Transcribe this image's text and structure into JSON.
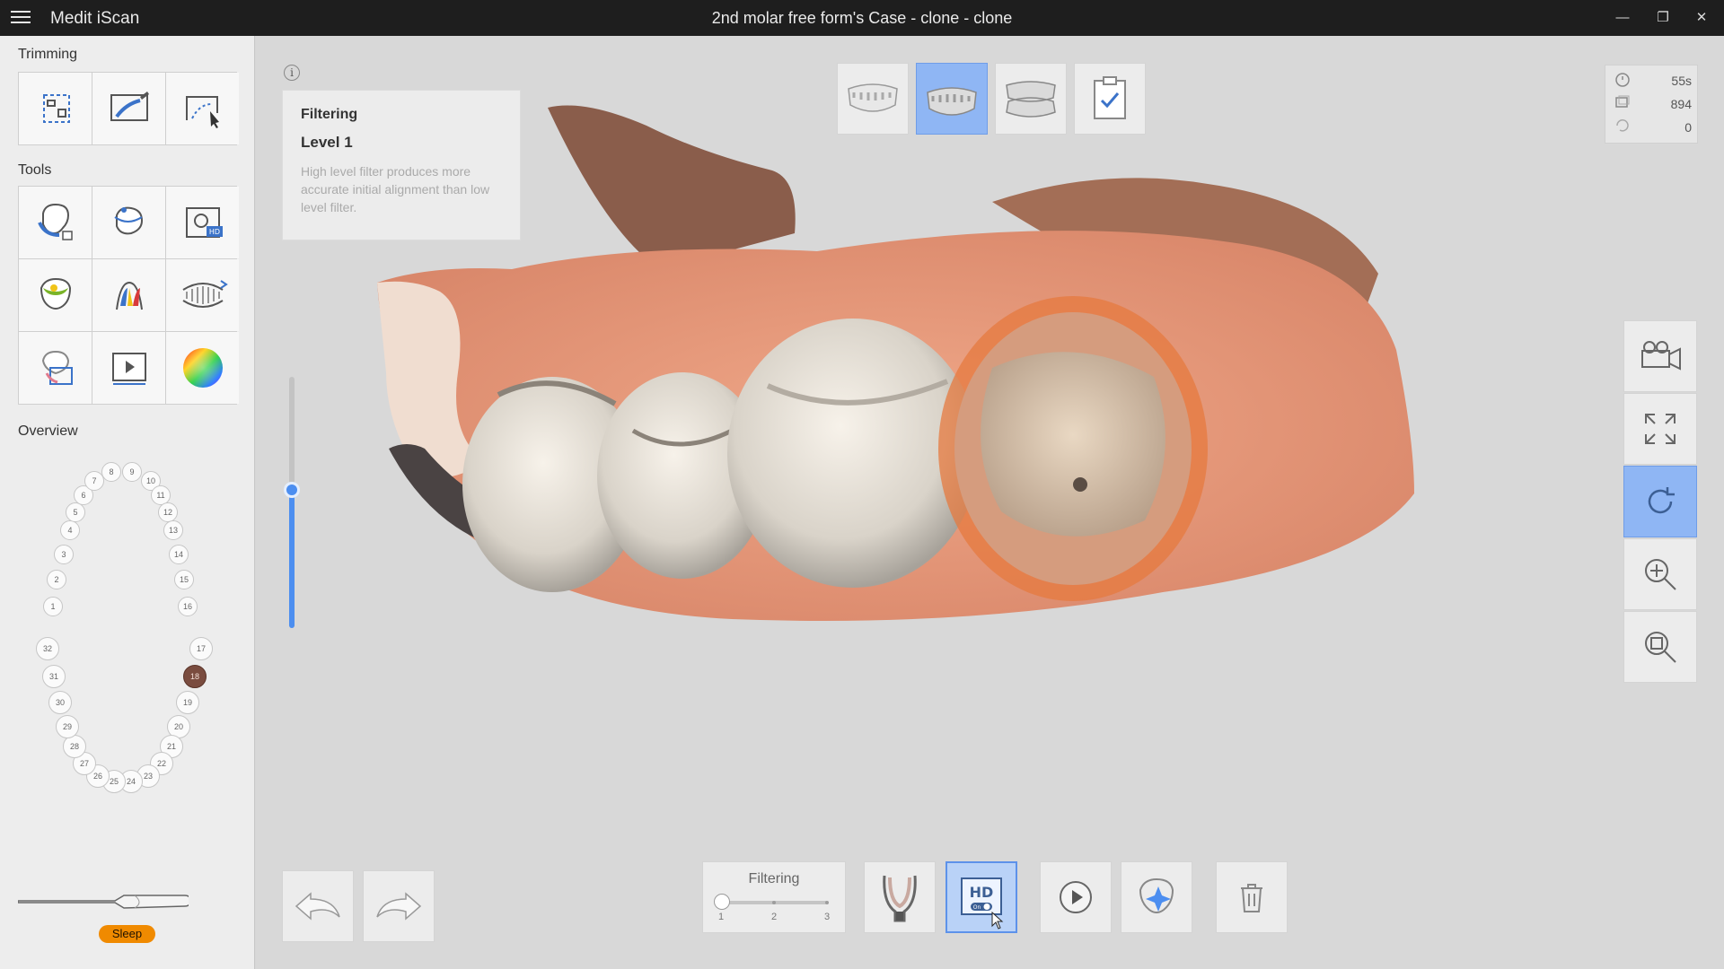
{
  "titlebar": {
    "app_name": "Medit iScan",
    "document_title": "2nd molar free form's Case - clone - clone",
    "minimize": "—",
    "restore": "❐",
    "close": "✕"
  },
  "left_panel": {
    "trimming_label": "Trimming",
    "tools_label": "Tools",
    "overview_label": "Overview",
    "scanner_status": "Sleep",
    "upper_teeth": [
      "1",
      "2",
      "3",
      "4",
      "5",
      "6",
      "7",
      "8",
      "9",
      "10",
      "11",
      "12",
      "13",
      "14",
      "15",
      "16"
    ],
    "lower_teeth": [
      "17",
      "18",
      "19",
      "20",
      "21",
      "22",
      "23",
      "24",
      "25",
      "26",
      "27",
      "28",
      "29",
      "30",
      "31",
      "32"
    ],
    "selected_tooth": "18"
  },
  "info_card": {
    "title": "Filtering",
    "level": "Level 1",
    "description": "High level filter produces more accurate initial alignment than low level filter."
  },
  "stats": {
    "time": "55s",
    "frames": "894",
    "count": "0"
  },
  "bottom": {
    "filter_label": "Filtering",
    "ticks": [
      "1",
      "2",
      "3"
    ],
    "filter_level": 1,
    "hd_label": "HD",
    "hd_state": "On"
  },
  "colors": {
    "accent": "#4c8ef0",
    "active_tile": "#8fb6f4",
    "sleep": "#f08a00",
    "titlebar": "#1e1e1e"
  }
}
